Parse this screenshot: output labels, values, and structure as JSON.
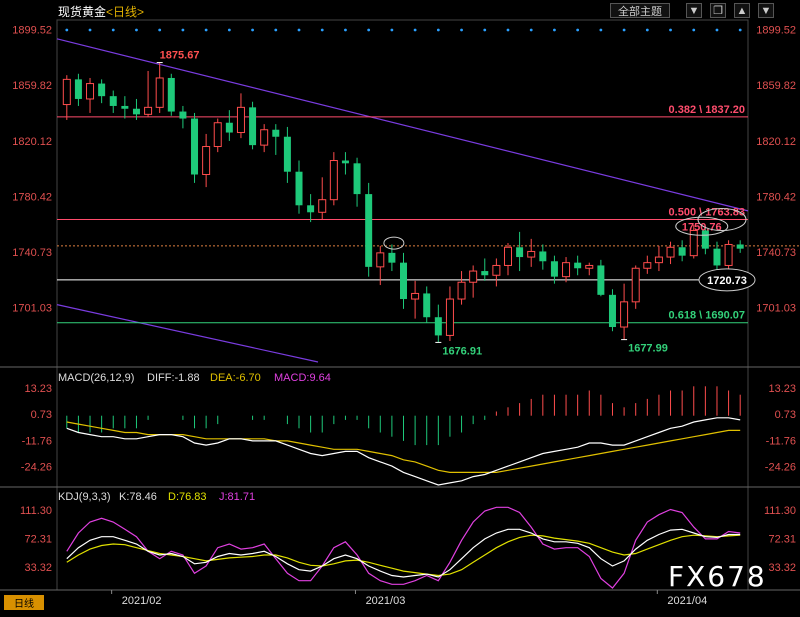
{
  "header": {
    "title": "现货黄金",
    "timeframe": "<日线>",
    "theme_button": "全部主题",
    "menu_icon": "dropdown-arrow-icon",
    "ctrl_icons": [
      "window-restore-icon",
      "chevron-up-icon",
      "chevron-down-icon"
    ]
  },
  "bottom_timeframe": "日线",
  "watermark": "FX678",
  "colors": {
    "up": "#ff4d4d",
    "down": "#33d17a",
    "candle_fill": "#1ec97a",
    "fib_line": "#ff4d6d",
    "trend_line": "#7a3ce0",
    "diff_line": "#ffffff",
    "dea_line": "#e0c000",
    "macd_label": "#e040e0",
    "k_line": "#ffffff",
    "d_line": "#e0e000",
    "j_line": "#e040e0",
    "green_line": "#33d17a"
  },
  "chart_data": [
    {
      "type": "candlestick",
      "yticks": [
        "1899.52",
        "1859.82",
        "1820.12",
        "1780.42",
        "1740.73",
        "1701.03"
      ],
      "ylim": [
        1662,
        1905
      ],
      "xticks": [
        "2021/02",
        "2021/03",
        "2021/04"
      ],
      "annotations": {
        "high_label": "1875.67",
        "low1_label": "1676.91",
        "low2_label": "1677.99",
        "fib382": "0.382 \\ 1837.20",
        "fib500": "0.500 \\ 1763.83",
        "fib618": "0.618 \\ 1690.07",
        "mark1750": "1750.76",
        "mark1720": "1720.73"
      },
      "levels": {
        "fib382": 1837.2,
        "fib500": 1763.83,
        "fib618": 1690.07,
        "white": 1720.73,
        "dashed": 1745.0
      },
      "ohlc": [
        [
          1846,
          1867,
          1835,
          1864
        ],
        [
          1864,
          1868,
          1845,
          1850
        ],
        [
          1850,
          1865,
          1840,
          1861
        ],
        [
          1861,
          1864,
          1847,
          1852
        ],
        [
          1852,
          1856,
          1840,
          1845
        ],
        [
          1845,
          1852,
          1836,
          1843
        ],
        [
          1843,
          1850,
          1835,
          1839
        ],
        [
          1839,
          1870,
          1837,
          1844
        ],
        [
          1844,
          1876,
          1840,
          1865
        ],
        [
          1865,
          1868,
          1838,
          1841
        ],
        [
          1841,
          1845,
          1829,
          1836
        ],
        [
          1836,
          1840,
          1790,
          1796
        ],
        [
          1796,
          1825,
          1787,
          1816
        ],
        [
          1816,
          1836,
          1812,
          1833
        ],
        [
          1833,
          1842,
          1820,
          1826
        ],
        [
          1826,
          1854,
          1822,
          1844
        ],
        [
          1844,
          1848,
          1814,
          1817
        ],
        [
          1817,
          1832,
          1812,
          1828
        ],
        [
          1828,
          1832,
          1810,
          1823
        ],
        [
          1823,
          1830,
          1790,
          1798
        ],
        [
          1798,
          1806,
          1768,
          1774
        ],
        [
          1774,
          1782,
          1762,
          1769
        ],
        [
          1769,
          1794,
          1764,
          1778
        ],
        [
          1778,
          1812,
          1774,
          1806
        ],
        [
          1806,
          1812,
          1796,
          1804
        ],
        [
          1804,
          1808,
          1773,
          1782
        ],
        [
          1782,
          1790,
          1723,
          1730
        ],
        [
          1730,
          1745,
          1717,
          1740
        ],
        [
          1740,
          1746,
          1727,
          1733
        ],
        [
          1733,
          1740,
          1700,
          1707
        ],
        [
          1707,
          1720,
          1693,
          1711
        ],
        [
          1711,
          1716,
          1690,
          1694
        ],
        [
          1694,
          1703,
          1676,
          1681
        ],
        [
          1681,
          1716,
          1677,
          1707
        ],
        [
          1707,
          1727,
          1703,
          1719
        ],
        [
          1719,
          1731,
          1708,
          1727
        ],
        [
          1727,
          1736,
          1720,
          1724
        ],
        [
          1724,
          1736,
          1716,
          1731
        ],
        [
          1731,
          1747,
          1724,
          1744
        ],
        [
          1744,
          1755,
          1727,
          1737
        ],
        [
          1737,
          1750,
          1730,
          1741
        ],
        [
          1741,
          1746,
          1728,
          1734
        ],
        [
          1734,
          1738,
          1718,
          1723
        ],
        [
          1723,
          1737,
          1719,
          1733
        ],
        [
          1733,
          1738,
          1724,
          1729
        ],
        [
          1729,
          1733,
          1724,
          1731
        ],
        [
          1731,
          1735,
          1709,
          1710
        ],
        [
          1710,
          1714,
          1684,
          1687
        ],
        [
          1687,
          1718,
          1678,
          1705
        ],
        [
          1705,
          1731,
          1700,
          1729
        ],
        [
          1729,
          1738,
          1725,
          1733
        ],
        [
          1733,
          1745,
          1727,
          1737
        ],
        [
          1737,
          1748,
          1732,
          1744
        ],
        [
          1744,
          1749,
          1734,
          1738
        ],
        [
          1738,
          1760,
          1736,
          1756
        ],
        [
          1756,
          1759,
          1739,
          1743
        ],
        [
          1743,
          1748,
          1728,
          1731
        ],
        [
          1731,
          1749,
          1724,
          1746
        ],
        [
          1746,
          1749,
          1740,
          1743
        ]
      ]
    },
    {
      "type": "macd",
      "legend": {
        "title": "MACD(26,12,9)",
        "diff": "DIFF:-1.88",
        "dea": "DEA:-6.70",
        "macd": "MACD:9.64"
      },
      "yticks": [
        "13.23",
        "0.73",
        "-11.76",
        "-24.26"
      ],
      "ylim": [
        -33,
        17
      ],
      "diff": [
        -6,
        -8,
        -9,
        -10,
        -10,
        -11,
        -11,
        -10,
        -9,
        -9,
        -10,
        -13,
        -14,
        -13,
        -11,
        -11,
        -12,
        -12,
        -12,
        -14,
        -16,
        -18,
        -19,
        -18,
        -17,
        -17,
        -20,
        -22,
        -24,
        -27,
        -29,
        -31,
        -33,
        -32,
        -31,
        -29,
        -28,
        -26,
        -24,
        -22,
        -20,
        -18,
        -17,
        -16,
        -15,
        -13,
        -13,
        -14,
        -14,
        -12,
        -10,
        -8,
        -6,
        -5,
        -3,
        -2,
        -1,
        -1,
        -2
      ],
      "dea": [
        -3,
        -4,
        -5,
        -6,
        -7,
        -8,
        -8,
        -9,
        -9,
        -9,
        -9,
        -10,
        -11,
        -11,
        -11,
        -11,
        -11,
        -11,
        -12,
        -12,
        -13,
        -14,
        -15,
        -16,
        -16,
        -16,
        -17,
        -18,
        -19,
        -21,
        -22,
        -24,
        -26,
        -27,
        -27,
        -27,
        -27,
        -27,
        -26,
        -25,
        -24,
        -23,
        -22,
        -21,
        -20,
        -19,
        -18,
        -17,
        -16,
        -15,
        -14,
        -13,
        -12,
        -11,
        -10,
        -9,
        -8,
        -7,
        -7
      ],
      "macd": [
        -6,
        -8,
        -8,
        -8,
        -6,
        -6,
        -6,
        -2,
        0,
        0,
        -2,
        -6,
        -6,
        -4,
        0,
        0,
        -2,
        -2,
        0,
        -4,
        -6,
        -8,
        -8,
        -4,
        -2,
        -2,
        -6,
        -8,
        -10,
        -12,
        -14,
        -14,
        -14,
        -10,
        -8,
        -4,
        -2,
        2,
        4,
        6,
        8,
        10,
        10,
        10,
        10,
        12,
        10,
        6,
        4,
        6,
        8,
        10,
        12,
        12,
        14,
        14,
        14,
        12,
        10
      ]
    },
    {
      "type": "kdj",
      "legend": {
        "title": "KDJ(9,3,3)",
        "k": "K:78.46",
        "d": "D:76.83",
        "j": "J:81.71"
      },
      "yticks": [
        "111.30",
        "72.31",
        "33.32"
      ],
      "ylim": [
        5,
        125
      ],
      "k": [
        45,
        60,
        70,
        75,
        75,
        70,
        65,
        55,
        50,
        52,
        48,
        38,
        40,
        48,
        52,
        50,
        52,
        55,
        48,
        38,
        30,
        28,
        35,
        45,
        50,
        45,
        35,
        28,
        22,
        20,
        22,
        24,
        20,
        30,
        45,
        60,
        72,
        80,
        85,
        85,
        80,
        72,
        68,
        68,
        66,
        60,
        45,
        35,
        42,
        58,
        70,
        78,
        84,
        85,
        80,
        75,
        74,
        78,
        78
      ],
      "d": [
        40,
        50,
        58,
        63,
        65,
        64,
        60,
        56,
        52,
        50,
        48,
        45,
        42,
        44,
        46,
        47,
        48,
        50,
        50,
        46,
        40,
        36,
        35,
        38,
        42,
        43,
        40,
        36,
        32,
        28,
        26,
        24,
        22,
        24,
        30,
        40,
        50,
        60,
        68,
        74,
        77,
        76,
        73,
        71,
        69,
        66,
        60,
        54,
        50,
        52,
        58,
        64,
        70,
        75,
        77,
        76,
        75,
        76,
        77
      ],
      "j": [
        55,
        80,
        95,
        100,
        95,
        85,
        75,
        55,
        45,
        55,
        50,
        25,
        35,
        60,
        65,
        58,
        60,
        65,
        45,
        25,
        15,
        15,
        35,
        60,
        68,
        50,
        25,
        15,
        10,
        10,
        15,
        22,
        15,
        40,
        70,
        95,
        110,
        115,
        115,
        108,
        88,
        65,
        58,
        60,
        60,
        48,
        18,
        5,
        25,
        70,
        95,
        105,
        112,
        108,
        88,
        72,
        72,
        82,
        80
      ]
    }
  ]
}
